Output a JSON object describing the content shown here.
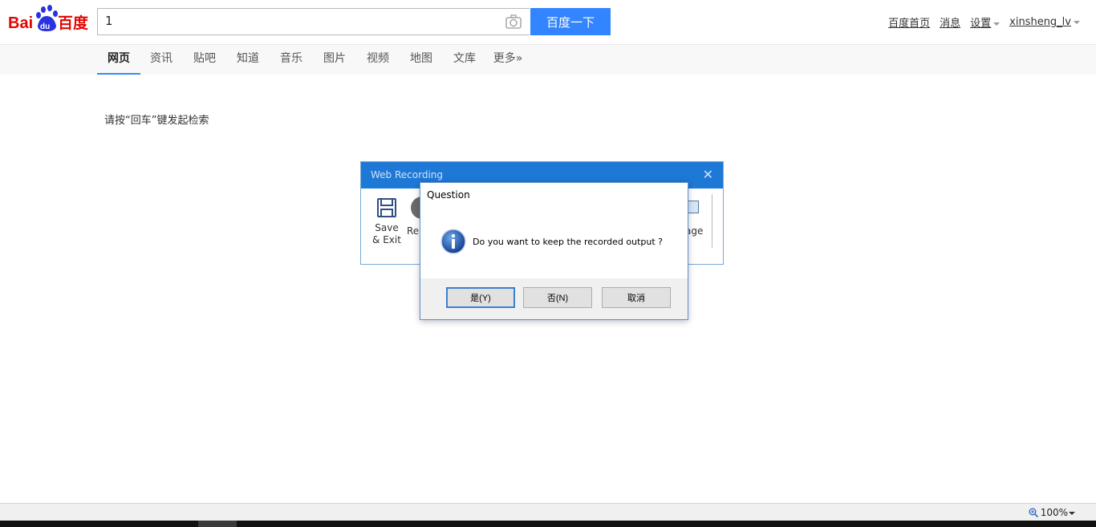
{
  "header": {
    "search_value": "1",
    "search_button": "百度一下",
    "links": [
      "百度首页",
      "消息",
      "设置",
      "xinsheng_lv"
    ]
  },
  "logo": {
    "text_bai": "Bai",
    "text_du": "du",
    "text_cn": "百度",
    "colors": {
      "red": "#e10601",
      "blue": "#2932e1"
    }
  },
  "tabs": [
    "网页",
    "资讯",
    "贴吧",
    "知道",
    "音乐",
    "图片",
    "视频",
    "地图",
    "文库",
    "更多»"
  ],
  "hint": "请按“回车”键发起检索",
  "recorder": {
    "title": "Web Recording",
    "save_label_1": "Save",
    "save_label_2": "& Exit",
    "rec_label": "Re",
    "page_label": "age"
  },
  "dialog": {
    "title": "Question",
    "message": "Do you want to keep the recorded output ?",
    "buttons": [
      "是(Y)",
      "否(N)",
      "取消"
    ]
  },
  "statusbar": {
    "zoom": "100%"
  },
  "colors": {
    "accent": "#3385ff",
    "title_bar": "#1e78d6"
  }
}
